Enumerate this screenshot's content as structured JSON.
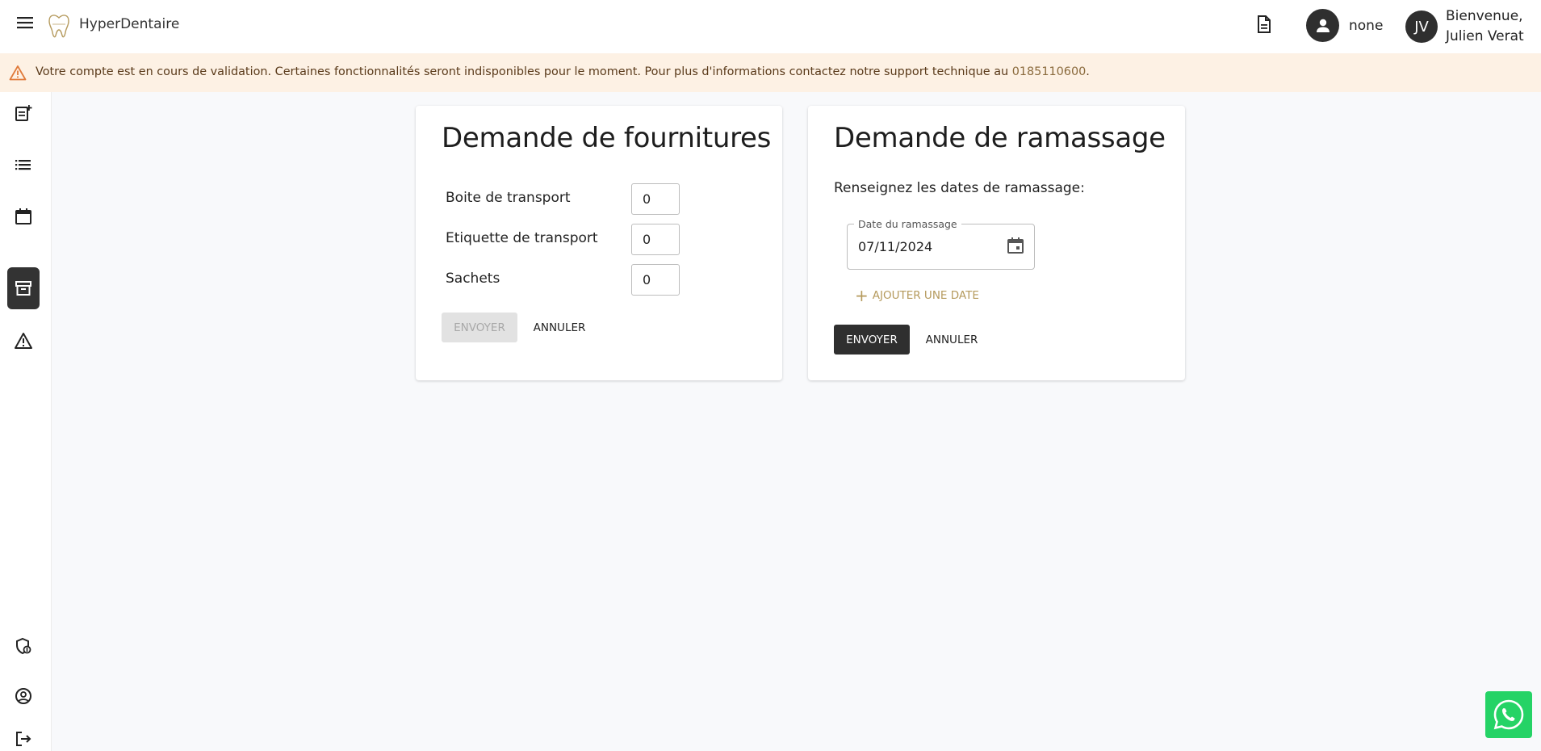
{
  "header": {
    "app_name": "HyperDentaire",
    "user_label": "none",
    "initials": "JV",
    "welcome_line1": "Bienvenue,",
    "welcome_line2": "Julien Verat"
  },
  "banner": {
    "text": "Votre compte est en cours de validation. Certaines fonctionnalités seront indisponibles pour le moment. Pour plus d'informations contactez notre support technique au ",
    "phone": "0185110600",
    "suffix": ".",
    "color": "#fdf1e4"
  },
  "sidebar": {
    "items": [
      {
        "icon": "new-order-icon"
      },
      {
        "icon": "list-icon"
      },
      {
        "icon": "calendar-icon"
      },
      {
        "icon": "archive-icon",
        "active": true
      },
      {
        "icon": "warning-icon"
      },
      {
        "icon": "security-icon"
      },
      {
        "icon": "account-icon"
      },
      {
        "icon": "logout-icon"
      }
    ]
  },
  "supplies": {
    "title": "Demande de fournitures",
    "rows": [
      {
        "label": "Boite de transport",
        "value": "0"
      },
      {
        "label": "Etiquette de transport",
        "value": "0"
      },
      {
        "label": "Sachets",
        "value": "0"
      }
    ],
    "send_label": "ENVOYER",
    "cancel_label": "ANNULER"
  },
  "pickup": {
    "title": "Demande de ramassage",
    "subtitle": "Renseignez les dates de ramassage:",
    "date_label": "Date du ramassage",
    "date_value": "07/11/2024",
    "add_date_label": "AJOUTER UNE DATE",
    "send_label": "ENVOYER",
    "cancel_label": "ANNULER"
  },
  "colors": {
    "accent_dark": "#2f2f2f",
    "gold": "#b59a5d",
    "whatsapp": "#25d366"
  }
}
